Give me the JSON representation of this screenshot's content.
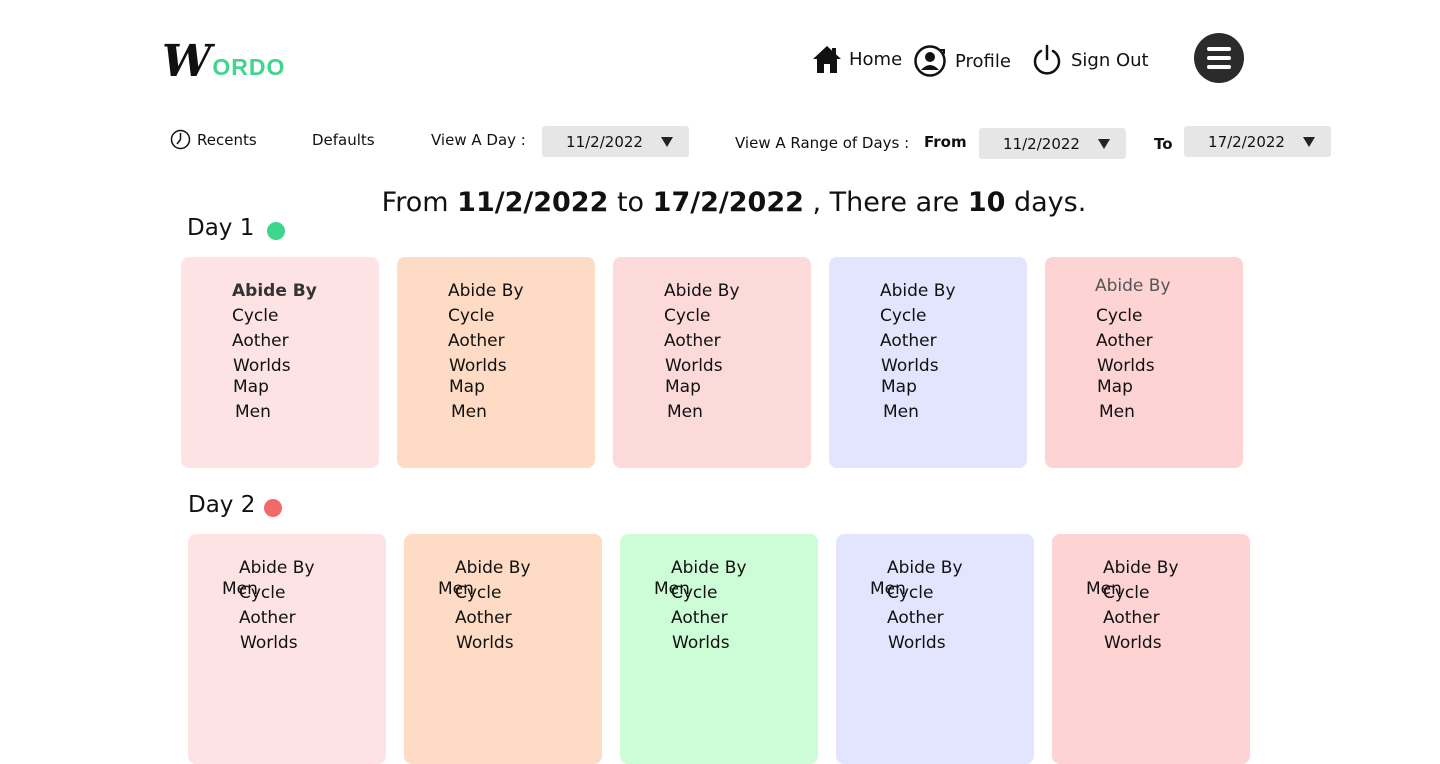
{
  "logo": {
    "letter": "W",
    "rest": "ORDO"
  },
  "nav": {
    "home": "Home",
    "profile": "Profile",
    "signout": "Sign Out"
  },
  "toolbar": {
    "recents": "Recents",
    "defaults": "Defaults",
    "view_day": "View  A Day :",
    "view_day_value": "11/2/2022",
    "view_range": "View  A Range of Days :",
    "from": "From",
    "from_value": "11/2/2022",
    "to": "To",
    "to_value": "17/2/2022"
  },
  "summary": {
    "p1": "From ",
    "from": "11/2/2022",
    "p2": " to ",
    "to": "17/2/2022",
    "p3": " ,  There are ",
    "count": "10",
    "p4": " days."
  },
  "days": [
    {
      "label": "Day 1",
      "dot_color": "#3dd68c",
      "cards": [
        {
          "bg": "#fde3e3",
          "lines": [
            "Abide By",
            "Cycle",
            "Aother",
            "Worlds",
            "Map",
            "Men"
          ]
        },
        {
          "bg": "#fddbc4",
          "lines": [
            "Abide By",
            "Cycle",
            "Aother",
            "Worlds",
            "Map",
            "Men"
          ]
        },
        {
          "bg": "#fddada",
          "lines": [
            "Abide By",
            "Cycle",
            "Aother",
            "Worlds",
            "Map",
            "Men"
          ]
        },
        {
          "bg": "#e2e5fd",
          "lines": [
            "Abide By",
            "Cycle",
            "Aother",
            "Worlds",
            "Map",
            "Men"
          ]
        },
        {
          "bg": "#fdd3d3",
          "lines": [
            "Abide By",
            "Cycle",
            "Aother",
            "Worlds",
            "Map",
            "Men"
          ]
        }
      ]
    },
    {
      "label": "Day 2",
      "dot_color": "#f06a6a",
      "cards": [
        {
          "bg": "#fde3e3",
          "lines": [
            "Abide By",
            "Cycle",
            "Aother",
            "Worlds",
            "Men"
          ]
        },
        {
          "bg": "#fddbc4",
          "lines": [
            "Abide By",
            "Cycle",
            "Aother",
            "Worlds",
            "Men"
          ]
        },
        {
          "bg": "#cdfdd6",
          "lines": [
            "Abide By",
            "Cycle",
            "Aother",
            "Worlds",
            "Men"
          ]
        },
        {
          "bg": "#e2e5fd",
          "lines": [
            "Abide By",
            "Cycle",
            "Aother",
            "Worlds",
            "Men"
          ]
        },
        {
          "bg": "#fdd3d3",
          "lines": [
            "Abide By",
            "Cycle",
            "Aother",
            "Worlds",
            "Men"
          ]
        }
      ]
    }
  ]
}
